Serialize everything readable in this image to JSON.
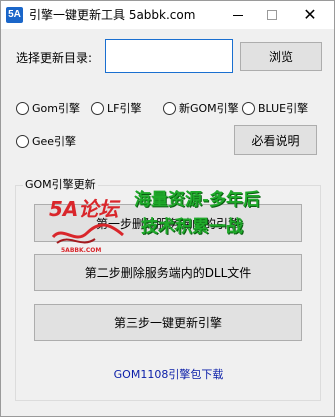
{
  "window": {
    "icon_text": "5A",
    "title": "引擎一键更新工具 5abbk.com",
    "close_glyph": "✕"
  },
  "form": {
    "dir_label": "选择更新目录:",
    "dir_value": "",
    "browse_label": "浏览"
  },
  "engines": {
    "options": [
      "Gom引擎",
      "LF引擎",
      "新GOM引擎",
      "BLUE引擎",
      "Gee引擎"
    ],
    "selected": null
  },
  "readme_label": "必看说明",
  "group": {
    "title": "GOM引擎更新",
    "step1_label": "第一步删除服务端内的引擎",
    "step2_label": "第二步删除服务端内的DLL文件",
    "step3_label": "第三步一键更新引擎",
    "download_link": "GOM1108引擎包下载"
  },
  "watermark": {
    "logo_text": "5A论坛",
    "logo_sub": "5ABBK.COM",
    "line1": "海量资源-多年后",
    "line2": "技术积累一战"
  },
  "colors": {
    "accent": "#1a6fd0",
    "link": "#0a1ea8",
    "watermark_green": "#1faa2a",
    "watermark_red": "#d9262b"
  }
}
